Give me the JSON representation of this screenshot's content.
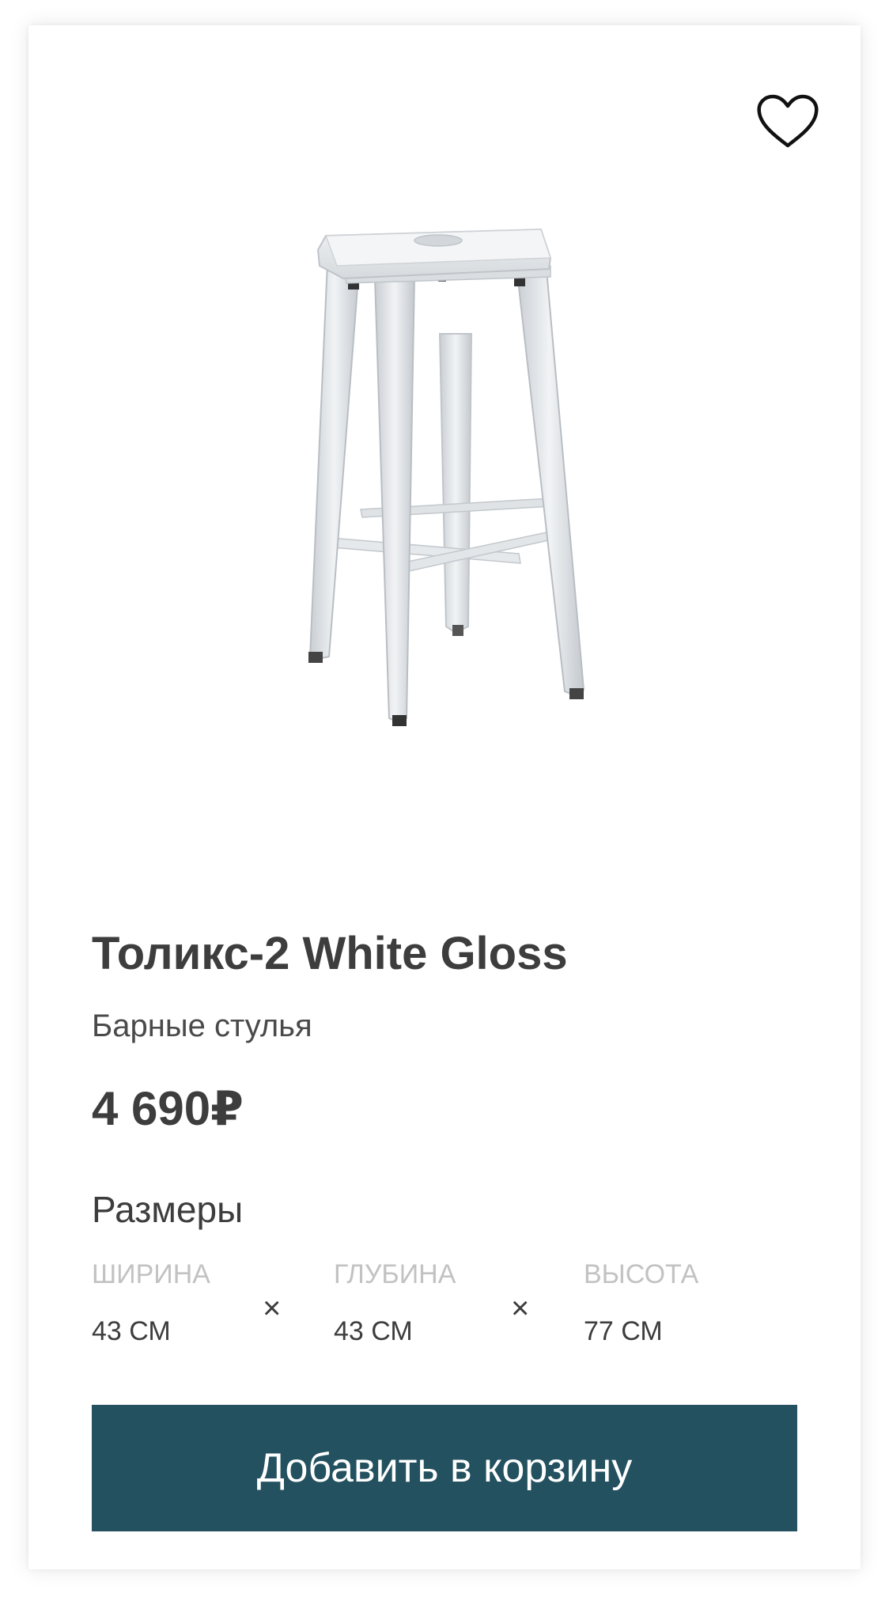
{
  "product": {
    "title": "Толикс-2 White Gloss",
    "category": "Барные стулья",
    "price": "4 690₽",
    "favorite_icon": "heart-outline-icon",
    "image_subject": "bar-stool-image"
  },
  "dimensions": {
    "heading": "Размеры",
    "separator": "×",
    "items": [
      {
        "label": "ШИРИНА",
        "value": "43 СМ"
      },
      {
        "label": "ГЛУБИНА",
        "value": "43 СМ"
      },
      {
        "label": "ВЫСОТА",
        "value": "77 СМ"
      }
    ]
  },
  "actions": {
    "add_to_cart_label": "Добавить в корзину"
  },
  "colors": {
    "button_bg": "#23515f",
    "text_dark": "#3d3d3d",
    "text_muted": "#c2c2c2"
  }
}
